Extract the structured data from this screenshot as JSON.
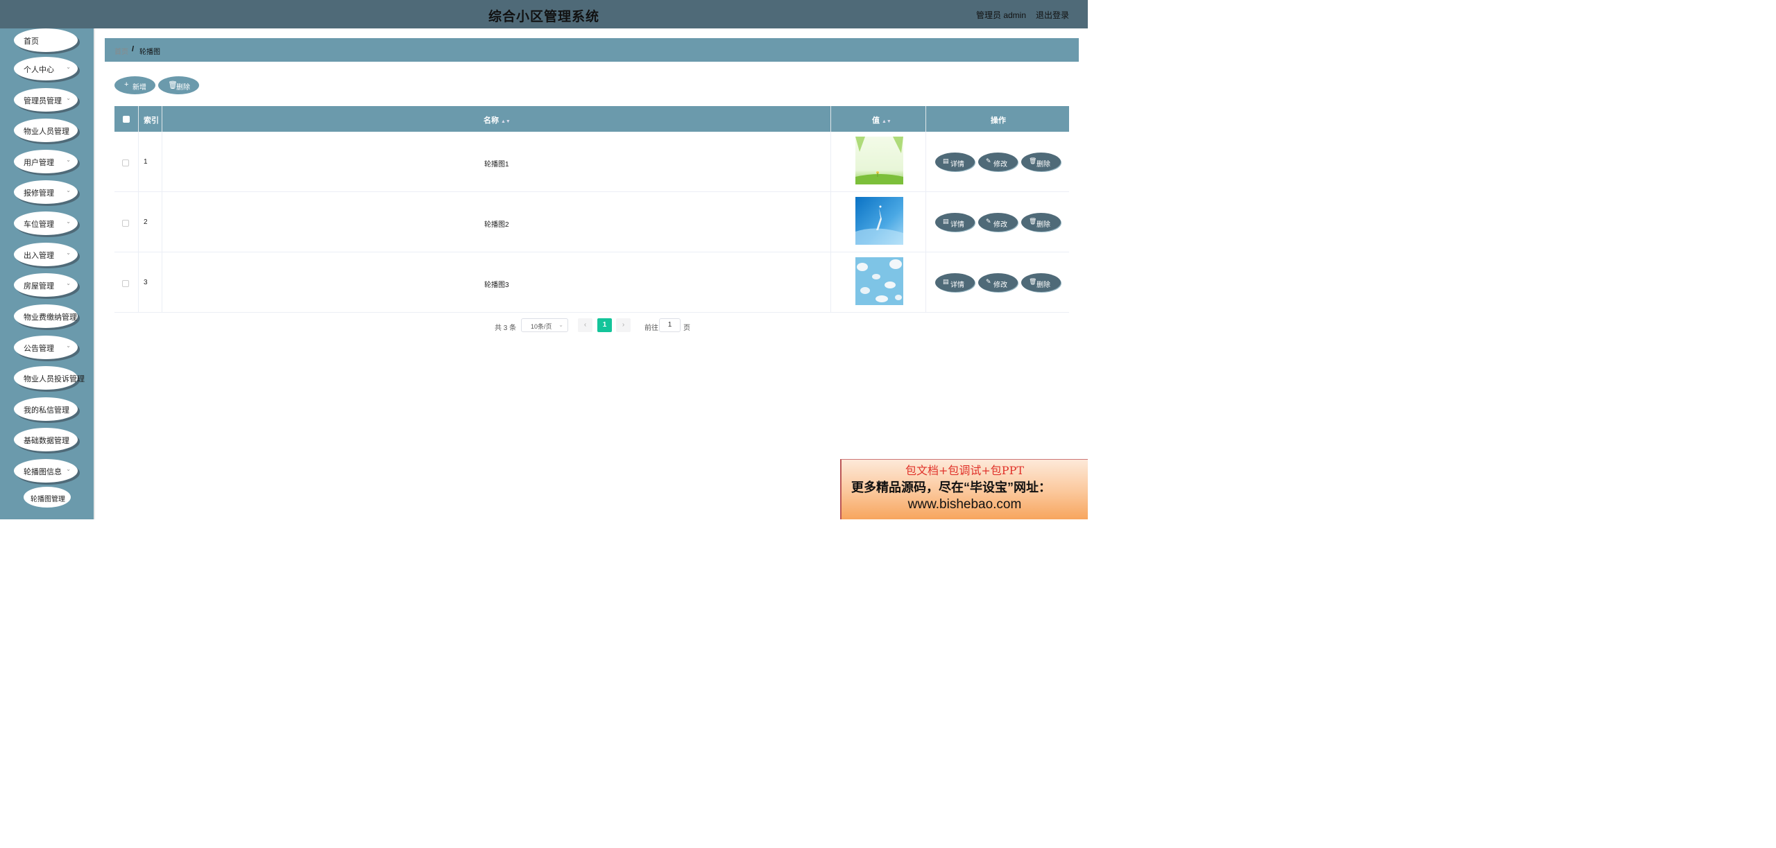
{
  "header": {
    "title": "综合小区管理系统",
    "admin_label": "管理员 admin",
    "logout_label": "退出登录"
  },
  "sidebar": {
    "items": [
      {
        "label": "首页",
        "has_chevron": false
      },
      {
        "label": "个人中心",
        "has_chevron": true
      },
      {
        "label": "管理员管理",
        "has_chevron": true
      },
      {
        "label": "物业人员管理",
        "has_chevron": false
      },
      {
        "label": "用户管理",
        "has_chevron": true
      },
      {
        "label": "报修管理",
        "has_chevron": true
      },
      {
        "label": "车位管理",
        "has_chevron": true
      },
      {
        "label": "出入管理",
        "has_chevron": true
      },
      {
        "label": "房屋管理",
        "has_chevron": true
      },
      {
        "label": "物业费缴纳管理",
        "has_chevron": false
      },
      {
        "label": "公告管理",
        "has_chevron": true
      },
      {
        "label": "物业人员投诉管理",
        "has_chevron": false
      },
      {
        "label": "我的私信管理",
        "has_chevron": false
      },
      {
        "label": "基础数据管理",
        "has_chevron": false
      },
      {
        "label": "轮播图信息",
        "has_chevron": true
      }
    ],
    "sub_item": {
      "label": "轮播图管理"
    }
  },
  "breadcrumb": {
    "home": "首页",
    "separator": "/",
    "current": "轮播图"
  },
  "toolbar": {
    "add_label": "新增",
    "delete_label": "删除"
  },
  "table": {
    "columns": {
      "index": "索引",
      "name": "名称",
      "value": "值",
      "actions": "操作"
    },
    "rows": [
      {
        "index": "1",
        "name": "轮播图1",
        "image": "green-meadow"
      },
      {
        "index": "2",
        "name": "轮播图2",
        "image": "blue-sky-bird"
      },
      {
        "index": "3",
        "name": "轮播图3",
        "image": "blue-clouds"
      }
    ],
    "actions": {
      "detail": "详情",
      "edit": "修改",
      "delete": "删除"
    }
  },
  "pagination": {
    "total": "共 3 条",
    "page_size": "10条/页",
    "current_page": "1",
    "goto_label": "前往",
    "goto_value": "1",
    "page_suffix": "页"
  },
  "ad": {
    "line1": "包文档+包调试+包PPT",
    "line2": "更多精品源码，尽在“毕设宝”网址：",
    "line3": "www.bishebao.com"
  },
  "colors": {
    "header_bg": "#4f6a78",
    "sidebar_bg": "#6b9aac",
    "action_button_bg": "#4f6a78",
    "pagination_active": "#14c49a"
  }
}
